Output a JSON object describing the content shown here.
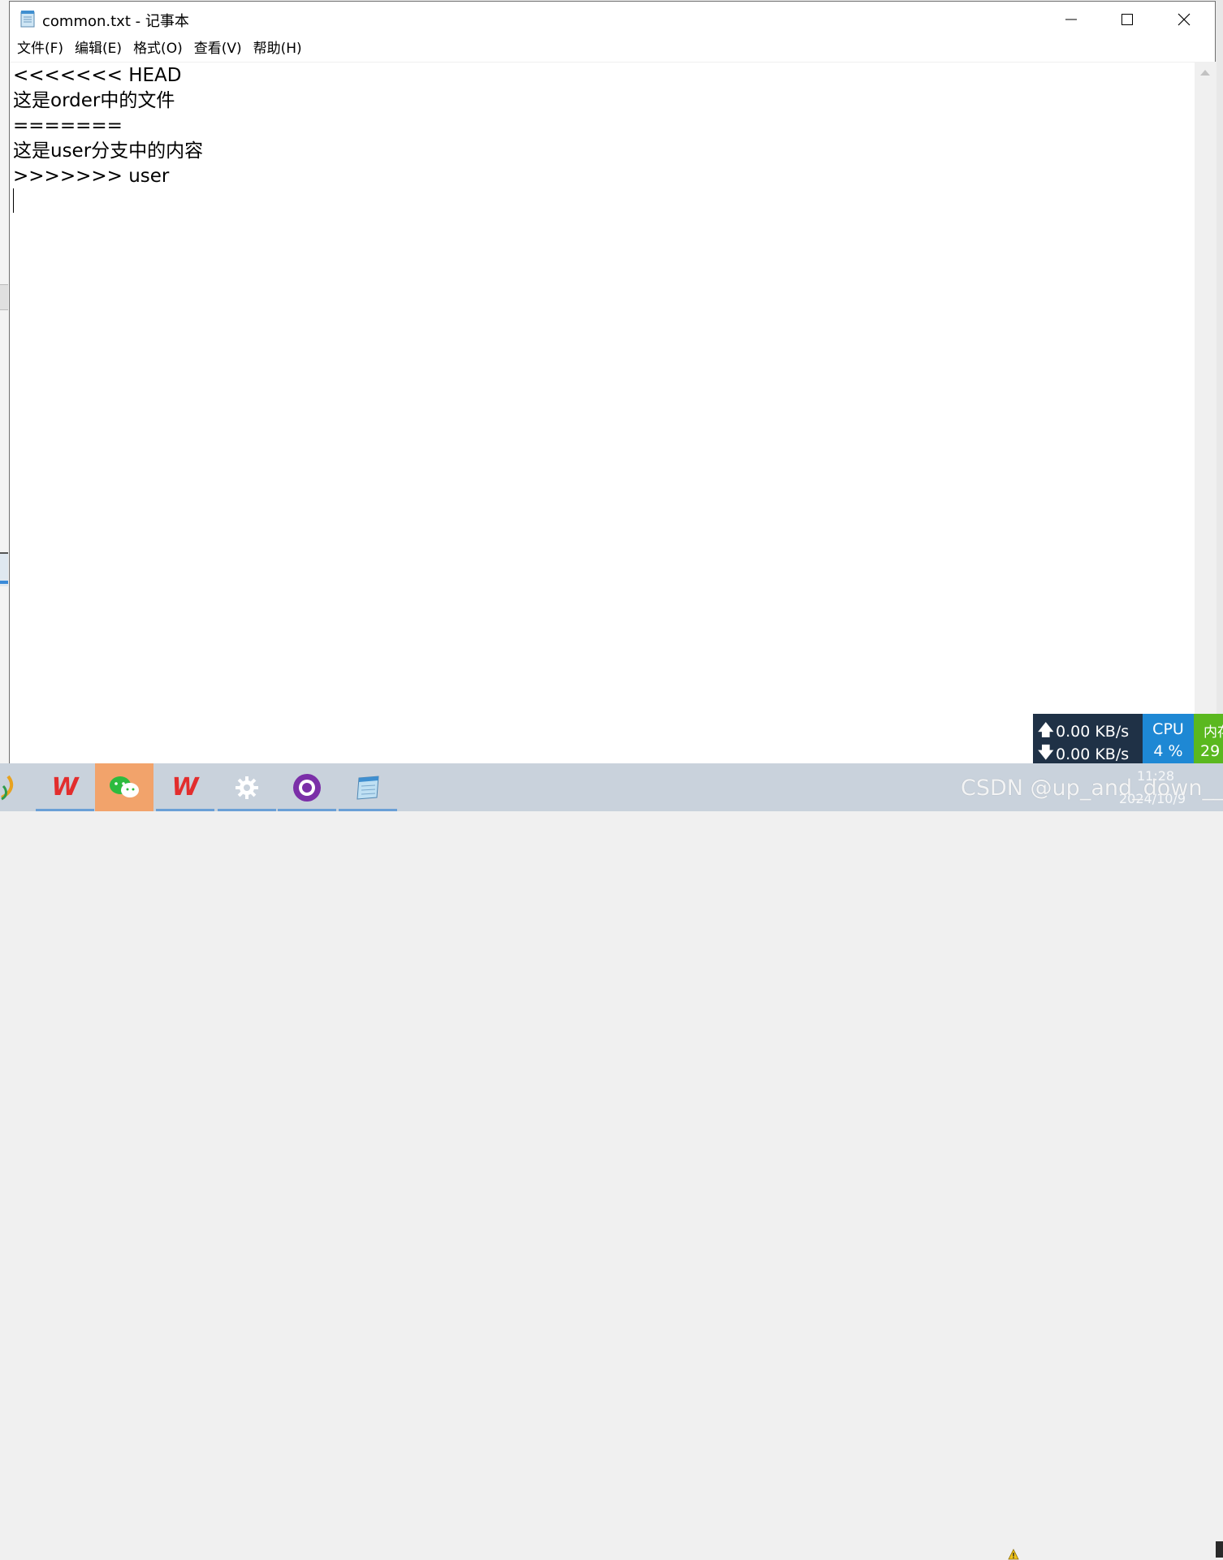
{
  "window": {
    "title": "common.txt - 记事本"
  },
  "menu": [
    {
      "label": "文件(F)"
    },
    {
      "label": "编辑(E)"
    },
    {
      "label": "格式(O)"
    },
    {
      "label": "查看(V)"
    },
    {
      "label": "帮助(H)"
    }
  ],
  "editor": {
    "lines": [
      "<<<<<<< HEAD",
      "这是order中的文件",
      "=======",
      "这是user分支中的内容",
      ">>>>>>> user"
    ]
  },
  "system_monitor": {
    "upload": "0.00 KB/s",
    "download": "0.00 KB/s",
    "cpu_label": "CPU",
    "cpu_value": "4 %",
    "mem_label": "内存",
    "mem_value": "29"
  },
  "taskbar": {
    "items": [
      {
        "icon": "wps-icon"
      },
      {
        "icon": "wechat-icon"
      },
      {
        "icon": "wps-icon"
      },
      {
        "icon": "settings-gear-icon"
      },
      {
        "icon": "github-desktop-icon"
      },
      {
        "icon": "notepad-icon"
      }
    ],
    "time": "11:28",
    "date": "2024/10/9"
  },
  "watermark": "CSDN @up_and_down__",
  "colors": {
    "net_bg": "#1f3146",
    "cpu_bg": "#1e88d4",
    "mem_bg": "#5ab81f",
    "taskbar_bg": "#c9d2dc",
    "active_taskbar": "#f2a36b"
  }
}
